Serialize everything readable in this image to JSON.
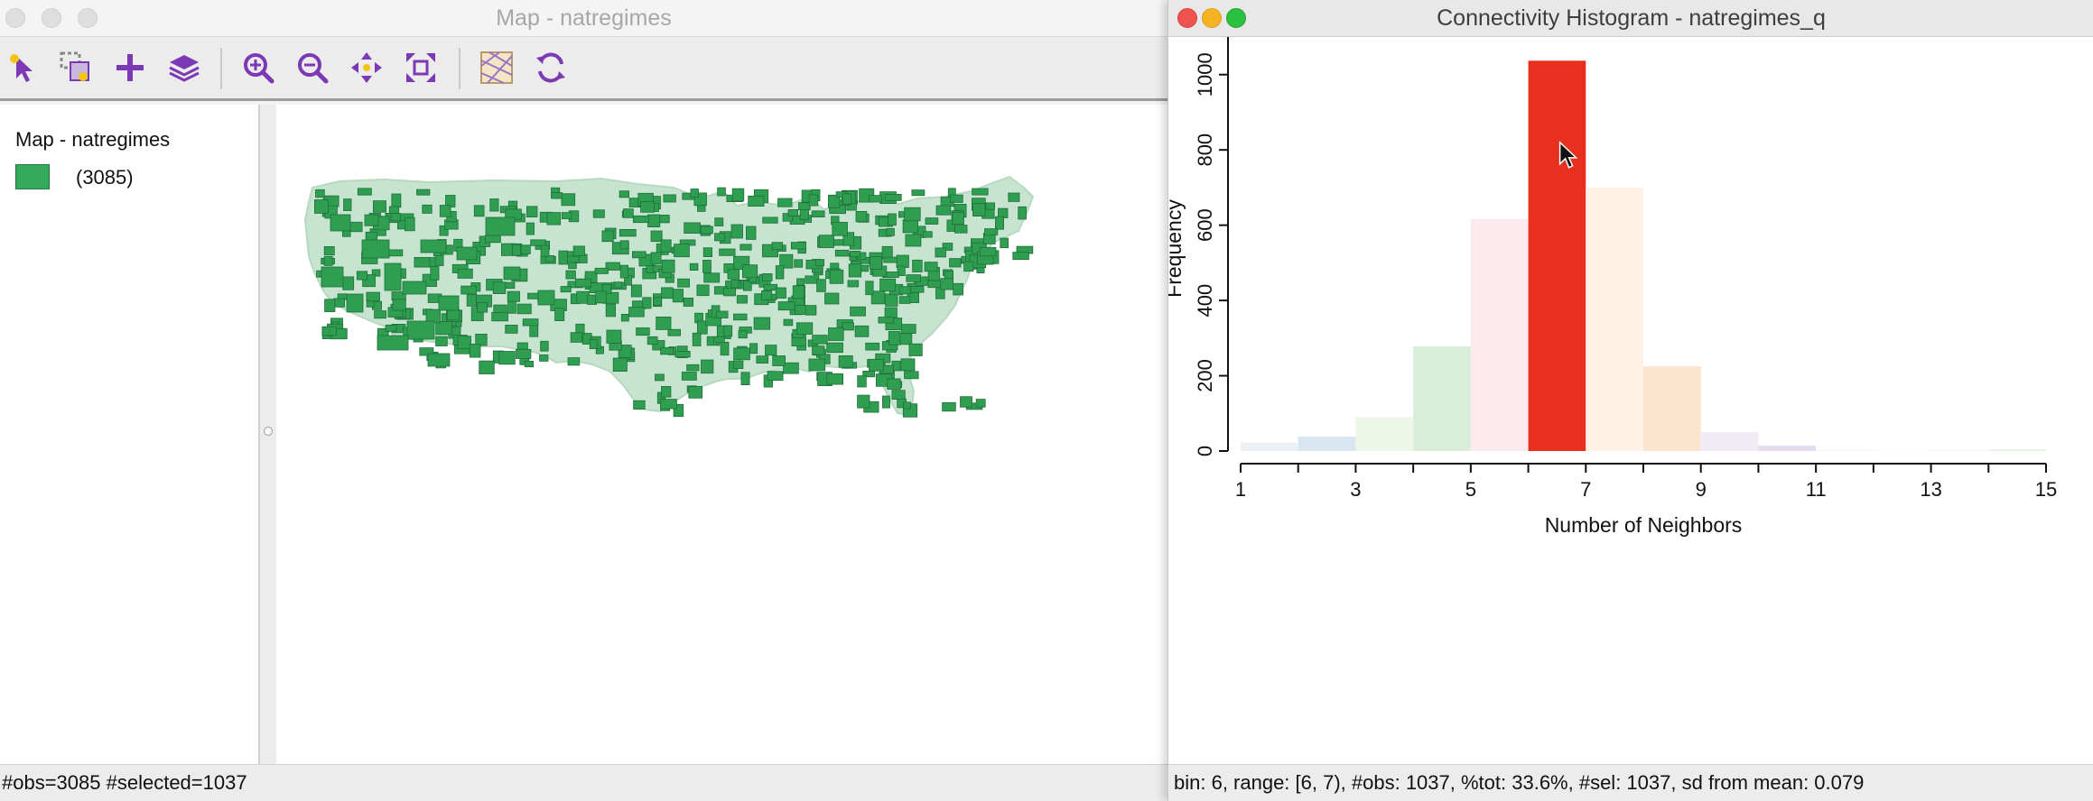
{
  "left_window": {
    "title": "Map - natregimes",
    "legend": {
      "title": "Map - natregimes",
      "items": [
        {
          "label": "(3085)",
          "color": "#35a95c"
        }
      ]
    },
    "status": "#obs=3085 #selected=1037",
    "toolbar": [
      {
        "name": "select-tool-icon"
      },
      {
        "name": "selection-shape-icon"
      },
      {
        "name": "add-layer-icon"
      },
      {
        "name": "layers-icon"
      },
      {
        "name": "zoom-in-icon"
      },
      {
        "name": "zoom-out-icon"
      },
      {
        "name": "pan-icon"
      },
      {
        "name": "fit-extent-icon"
      },
      {
        "name": "basemap-icon"
      },
      {
        "name": "refresh-icon"
      }
    ],
    "map_colors": {
      "selected": "#2f9e51",
      "unselected": "#c6e4cf"
    }
  },
  "right_window": {
    "title": "Connectivity Histogram - natregimes_q",
    "status": "bin: 6, range: [6, 7), #obs: 1037, %tot: 33.6%, #sel: 1037, sd from mean: 0.079"
  },
  "chart_data": {
    "type": "bar",
    "xlabel": "Number of Neighbors",
    "ylabel": "Frequency",
    "xlim": [
      1,
      15
    ],
    "ylim": [
      0,
      1100
    ],
    "x_ticks": [
      1,
      3,
      5,
      7,
      9,
      11,
      13,
      15
    ],
    "y_ticks": [
      0,
      200,
      400,
      600,
      800,
      1000
    ],
    "bins": [
      {
        "start": 1,
        "end": 2,
        "value": 22,
        "color": "#eaf1f7",
        "selected": false
      },
      {
        "start": 2,
        "end": 3,
        "value": 38,
        "color": "#d9e6f1",
        "selected": false
      },
      {
        "start": 3,
        "end": 4,
        "value": 90,
        "color": "#eef6ea",
        "selected": false
      },
      {
        "start": 4,
        "end": 5,
        "value": 278,
        "color": "#d8eed8",
        "selected": false
      },
      {
        "start": 5,
        "end": 6,
        "value": 617,
        "color": "#fdeaee",
        "selected": false
      },
      {
        "start": 6,
        "end": 7,
        "value": 1037,
        "color": "#e8301f",
        "selected": true
      },
      {
        "start": 7,
        "end": 8,
        "value": 700,
        "color": "#fef2e4",
        "selected": false
      },
      {
        "start": 8,
        "end": 9,
        "value": 225,
        "color": "#fde4cf",
        "selected": false
      },
      {
        "start": 9,
        "end": 10,
        "value": 50,
        "color": "#f1ebf6",
        "selected": false
      },
      {
        "start": 10,
        "end": 11,
        "value": 14,
        "color": "#e4dcee",
        "selected": false
      },
      {
        "start": 11,
        "end": 12,
        "value": 3,
        "color": "#eef4f8",
        "selected": false
      },
      {
        "start": 12,
        "end": 13,
        "value": 1,
        "color": "#f4f8fb",
        "selected": false
      },
      {
        "start": 13,
        "end": 14,
        "value": 2,
        "color": "#f4eef8",
        "selected": false
      },
      {
        "start": 14,
        "end": 15,
        "value": 4,
        "color": "#e2f2e2",
        "selected": false
      }
    ]
  }
}
